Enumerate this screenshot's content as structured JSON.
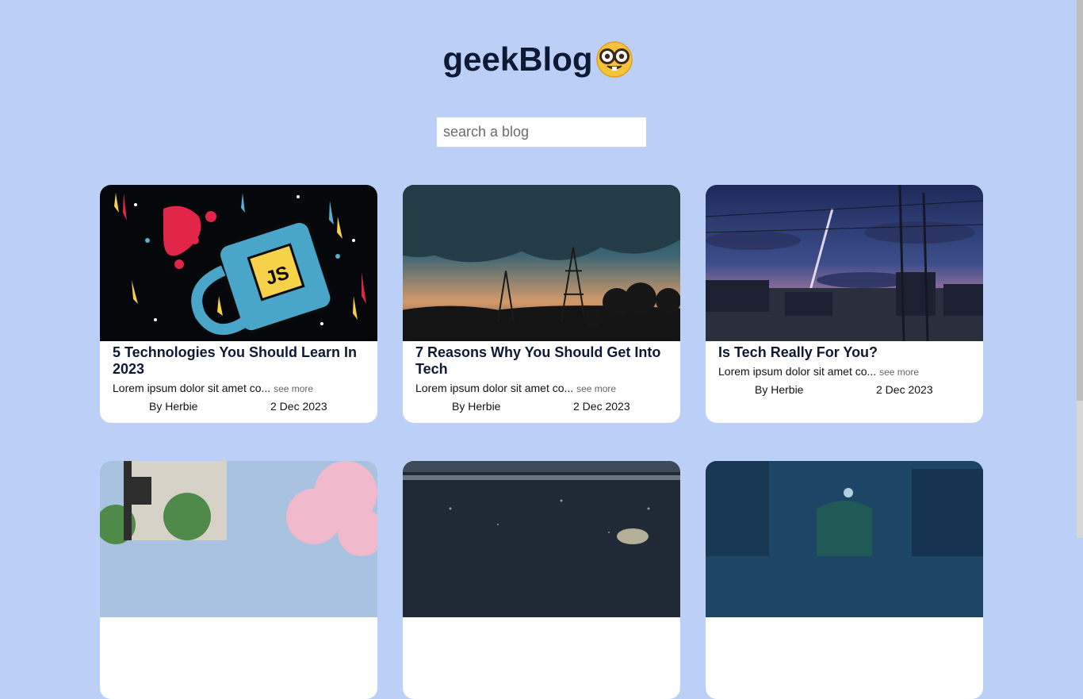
{
  "site": {
    "title": "geekBlog",
    "emoji_icon": "nerd-face-emoji"
  },
  "search": {
    "placeholder": "search a blog",
    "value": ""
  },
  "posts": [
    {
      "title": "5 Technologies You Should Learn In 2023",
      "excerpt": "Lorem ipsum dolor sit amet co...",
      "see_more": "see more",
      "author": "By Herbie",
      "date": "2 Dec 2023",
      "image": "javascript mug illustration"
    },
    {
      "title": "7 Reasons Why You Should Get Into Tech",
      "excerpt": "Lorem ipsum dolor sit amet co...",
      "see_more": "see more",
      "author": "By Herbie",
      "date": "2 Dec 2023",
      "image": "sunset power lines landscape"
    },
    {
      "title": "Is Tech Really For You?",
      "excerpt": "Lorem ipsum dolor sit amet co...",
      "see_more": "see more",
      "author": "By Herbie",
      "date": "2 Dec 2023",
      "image": "evening sky rocket trail"
    },
    {
      "title": "",
      "excerpt": "",
      "see_more": "",
      "author": "",
      "date": "",
      "image": "cherry blossom railway crossing"
    },
    {
      "title": "",
      "excerpt": "",
      "see_more": "",
      "author": "",
      "date": "",
      "image": "night train window"
    },
    {
      "title": "",
      "excerpt": "",
      "see_more": "",
      "author": "",
      "date": "",
      "image": "night town street lights"
    }
  ],
  "colors": {
    "background": "#bbcff7",
    "title": "#0e1a33",
    "card": "#ffffff"
  }
}
